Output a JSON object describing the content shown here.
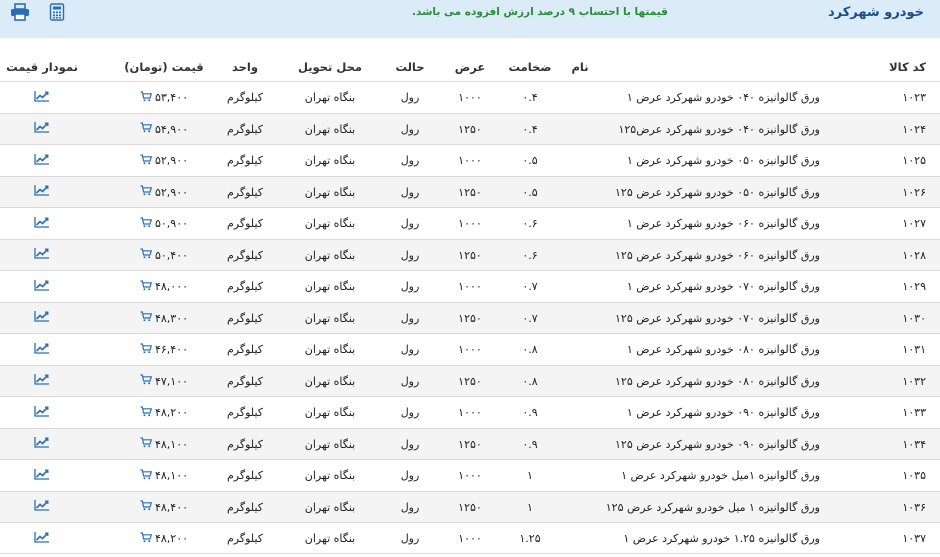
{
  "header": {
    "title": "خودرو شهرکرد",
    "notice": "قیمتها با احتساب ۹ درصد ارزش افزوده می باشد."
  },
  "colors": {
    "accent": "#1a4f86",
    "notice": "#2a8a3a",
    "topbar": "#dcebf8",
    "icon": "#2a6fb6"
  },
  "columns": {
    "code": "کد کالا",
    "name": "نام",
    "thickness": "ضخامت",
    "width": "عرض",
    "state": "حالت",
    "location": "محل تحویل",
    "unit": "واحد",
    "price": "قیمت (تومان)",
    "chart": "نمودار قیمت"
  },
  "rows": [
    {
      "code": "۱۰۲۳",
      "name": "ورق گالوانیزه ۰۴۰ خودرو شهرکرد عرض ۱",
      "thickness": "۰.۴",
      "width": "۱۰۰۰",
      "state": "رول",
      "location": "بنگاه تهران",
      "unit": "کیلوگرم",
      "price": "۵۳,۴۰۰"
    },
    {
      "code": "۱۰۲۴",
      "name": "ورق گالوانیزه ۰۴۰ خودرو شهرکرد عرض۱۲۵",
      "thickness": "۰.۴",
      "width": "۱۲۵۰",
      "state": "رول",
      "location": "بنگاه تهران",
      "unit": "کیلوگرم",
      "price": "۵۴,۹۰۰"
    },
    {
      "code": "۱۰۲۵",
      "name": "ورق گالوانیزه ۰۵۰ خودرو شهرکرد عرض ۱",
      "thickness": "۰.۵",
      "width": "۱۰۰۰",
      "state": "رول",
      "location": "بنگاه تهران",
      "unit": "کیلوگرم",
      "price": "۵۲,۹۰۰"
    },
    {
      "code": "۱۰۲۶",
      "name": "ورق گالوانیزه ۰۵۰ خودرو شهرکرد عرض ۱۲۵",
      "thickness": "۰.۵",
      "width": "۱۲۵۰",
      "state": "رول",
      "location": "بنگاه تهران",
      "unit": "کیلوگرم",
      "price": "۵۲,۹۰۰"
    },
    {
      "code": "۱۰۲۷",
      "name": "ورق گالوانیزه ۰۶۰ خودرو شهرکرد عرض ۱",
      "thickness": "۰.۶",
      "width": "۱۰۰۰",
      "state": "رول",
      "location": "بنگاه تهران",
      "unit": "کیلوگرم",
      "price": "۵۰,۹۰۰"
    },
    {
      "code": "۱۰۲۸",
      "name": "ورق گالوانیزه ۰۶۰ خودرو شهرکرد عرض ۱۲۵",
      "thickness": "۰.۶",
      "width": "۱۲۵۰",
      "state": "رول",
      "location": "بنگاه تهران",
      "unit": "کیلوگرم",
      "price": "۵۰,۴۰۰"
    },
    {
      "code": "۱۰۲۹",
      "name": "ورق گالوانیزه ۰۷۰ خودرو شهرکرد عرض ۱",
      "thickness": "۰.۷",
      "width": "۱۰۰۰",
      "state": "رول",
      "location": "بنگاه تهران",
      "unit": "کیلوگرم",
      "price": "۴۸,۰۰۰"
    },
    {
      "code": "۱۰۳۰",
      "name": "ورق گالوانیزه ۰۷۰ خودرو شهرکرد عرض ۱۲۵",
      "thickness": "۰.۷",
      "width": "۱۲۵۰",
      "state": "رول",
      "location": "بنگاه تهران",
      "unit": "کیلوگرم",
      "price": "۴۸,۳۰۰"
    },
    {
      "code": "۱۰۳۱",
      "name": "ورق گالوانیزه ۰۸۰ خودرو شهرکرد عرض ۱",
      "thickness": "۰.۸",
      "width": "۱۰۰۰",
      "state": "رول",
      "location": "بنگاه تهران",
      "unit": "کیلوگرم",
      "price": "۴۶,۴۰۰"
    },
    {
      "code": "۱۰۳۲",
      "name": "ورق گالوانیزه ۰۸۰ خودرو شهرکرد عرض ۱۲۵",
      "thickness": "۰.۸",
      "width": "۱۲۵۰",
      "state": "رول",
      "location": "بنگاه تهران",
      "unit": "کیلوگرم",
      "price": "۴۷,۱۰۰"
    },
    {
      "code": "۱۰۳۳",
      "name": "ورق گالوانیزه ۰۹۰ خودرو شهرکرد عرض ۱",
      "thickness": "۰.۹",
      "width": "۱۰۰۰",
      "state": "رول",
      "location": "بنگاه تهران",
      "unit": "کیلوگرم",
      "price": "۴۸,۲۰۰"
    },
    {
      "code": "۱۰۳۴",
      "name": "ورق گالوانیزه ۰۹۰ خودرو شهرکرد عرض ۱۲۵",
      "thickness": "۰.۹",
      "width": "۱۲۵۰",
      "state": "رول",
      "location": "بنگاه تهران",
      "unit": "کیلوگرم",
      "price": "۴۸,۱۰۰"
    },
    {
      "code": "۱۰۳۵",
      "name": "ورق گالوانیزه ۱میل خودرو شهرکرد عرض ۱",
      "thickness": "۱",
      "width": "۱۰۰۰",
      "state": "رول",
      "location": "بنگاه تهران",
      "unit": "کیلوگرم",
      "price": "۴۸,۱۰۰"
    },
    {
      "code": "۱۰۳۶",
      "name": "ورق گالوانیزه ۱ میل خودرو شهرکرد عرض ۱۲۵",
      "thickness": "۱",
      "width": "۱۲۵۰",
      "state": "رول",
      "location": "بنگاه تهران",
      "unit": "کیلوگرم",
      "price": "۴۸,۴۰۰"
    },
    {
      "code": "۱۰۳۷",
      "name": "ورق گالوانیزه ۱.۲۵ خودرو شهرکرد عرض ۱",
      "thickness": "۱.۲۵",
      "width": "۱۰۰۰",
      "state": "رول",
      "location": "بنگاه تهران",
      "unit": "کیلوگرم",
      "price": "۴۸,۲۰۰"
    }
  ]
}
